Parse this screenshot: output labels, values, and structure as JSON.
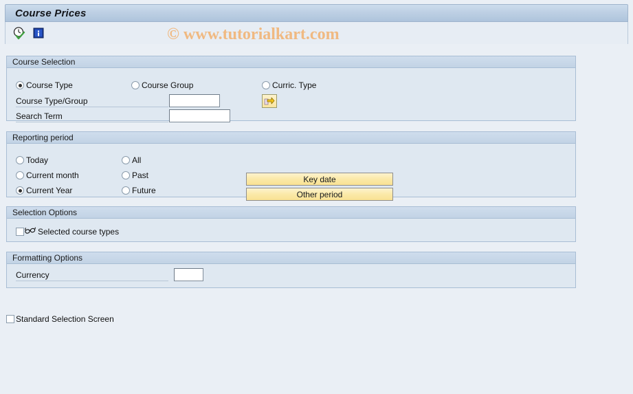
{
  "window": {
    "title": "Course Prices"
  },
  "toolbar": {
    "items": [
      {
        "name": "execute-icon",
        "label": "Execute"
      },
      {
        "name": "info-icon",
        "label": "Information"
      }
    ]
  },
  "watermark": {
    "text": "© www.tutorialkart.com",
    "color": "#f0b981"
  },
  "course_selection": {
    "header": "Course Selection",
    "radios": [
      {
        "label": "Course Type",
        "selected": true
      },
      {
        "label": "Course Group",
        "selected": false
      },
      {
        "label": "Curric. Type",
        "selected": false
      }
    ],
    "fields": [
      {
        "label": "Course Type/Group",
        "value": "",
        "placeholder": ""
      },
      {
        "label": "Search Term",
        "value": "",
        "placeholder": ""
      }
    ],
    "multi_select_button": "multiple-selection-arrow-icon"
  },
  "reporting_period": {
    "header": "Reporting period",
    "radios_left": [
      {
        "label": "Today",
        "selected": false
      },
      {
        "label": "Current month",
        "selected": false
      },
      {
        "label": "Current Year",
        "selected": true
      }
    ],
    "radios_right": [
      {
        "label": "All",
        "selected": false
      },
      {
        "label": "Past",
        "selected": false
      },
      {
        "label": "Future",
        "selected": false
      }
    ],
    "buttons": [
      {
        "label": "Key date"
      },
      {
        "label": "Other period"
      }
    ]
  },
  "selection_options": {
    "header": "Selection Options",
    "checkbox": {
      "label": "Selected course types",
      "checked": false,
      "icon": "glasses-icon"
    }
  },
  "formatting_options": {
    "header": "Formatting Options",
    "field": {
      "label": "Currency",
      "value": "",
      "placeholder": ""
    }
  },
  "footer": {
    "checkbox": {
      "label": "Standard Selection Screen",
      "checked": false
    }
  },
  "colors": {
    "background": "#eaeff5",
    "panel_bg": "#dfe8f1",
    "panel_border": "#a8bdd4",
    "titlebar": "#bed0e4",
    "button_yellow": "#fbe9a8"
  }
}
